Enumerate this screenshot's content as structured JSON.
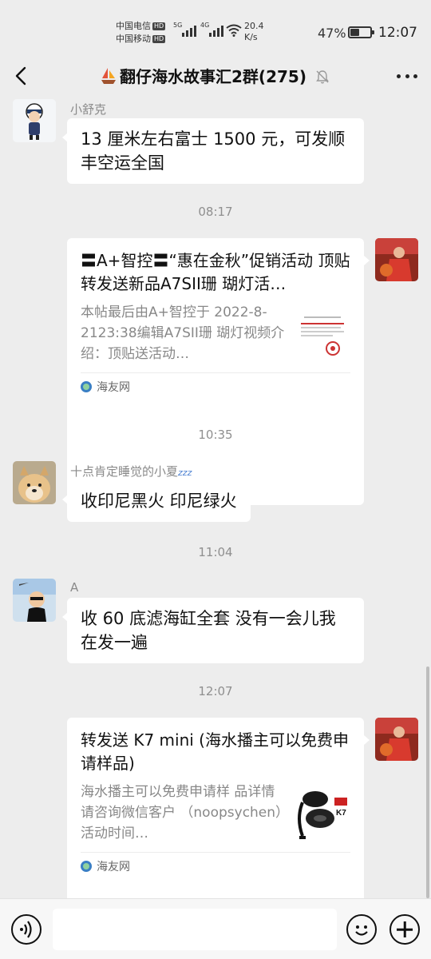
{
  "status_bar": {
    "carrier1": "中国电信",
    "carrier2": "中国移动",
    "hd": "HD",
    "net1": "5G",
    "net2": "4G",
    "speed_value": "20.4",
    "speed_unit": "K/s",
    "battery_pct": "47%",
    "battery_level": 0.47,
    "time": "12:07"
  },
  "header": {
    "title": "翻仔海水故事汇2群(275)",
    "muted": true
  },
  "messages": [
    {
      "type": "text",
      "sender": "小舒克",
      "text": "13 厘米左右富士 1500 元，可发顺丰空运全国"
    },
    {
      "type": "time",
      "text": "08:17"
    },
    {
      "type": "card",
      "title": "〓A+智控〓“惠在金秋”促销活动 顶贴转发送新品A7SII珊 瑚灯活…",
      "desc": "本帖最后由A+智控于 2022-8-2123:38编辑A7SII珊 瑚灯视频介绍：顶贴送活动…",
      "source": "海友网"
    },
    {
      "type": "time",
      "text": "10:35"
    },
    {
      "type": "text",
      "sender": "十点肯定睡觉的小夏",
      "sender_suffix": "zzz",
      "text": "收印尼黑火   印尼绿火"
    },
    {
      "type": "time",
      "text": "11:04"
    },
    {
      "type": "text",
      "sender": "A",
      "text": "收 60 底滤海缸全套   没有一会儿我在发一遍"
    },
    {
      "type": "time",
      "text": "12:07"
    },
    {
      "type": "card",
      "title": "转发送 K7 mini (海水播主可以免费申请样品)",
      "desc": "海水播主可以免费申请样 品详情请咨询微信客户 （noopsychen）活动时间…",
      "source": "海友网",
      "thumb_label": "K7"
    }
  ],
  "colors": {
    "background": "#ededed",
    "bubble": "#ffffff",
    "source_icon": "#3a7fc4"
  },
  "icons": {
    "back": "chevron-left-icon",
    "mute": "bell-off-icon",
    "more": "ellipsis-icon",
    "voice": "voice-icon",
    "emoji": "emoji-icon",
    "plus": "plus-icon"
  }
}
